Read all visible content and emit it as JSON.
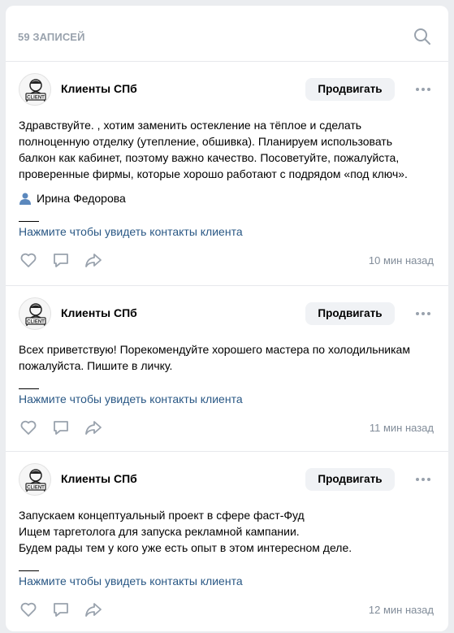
{
  "header": {
    "count": "59 ЗАПИСЕЙ"
  },
  "posts": [
    {
      "author": "Клиенты СПб",
      "promote": "Продвигать",
      "text": "Здравствуйте. , хотим заменить остекление на тёплое и сделать\nполноценную отделку (утепление, обшивка). Планируем использовать\nбалкон как кабинет, поэтому важно качество. Посоветуйте, пожалуйста,\nпроверенные фирмы, которые хорошо работают с подрядом «под ключ».",
      "signer": "Ирина Федорова",
      "contacts": "Нажмите чтобы увидеть контакты клиента",
      "time": "10 мин назад"
    },
    {
      "author": "Клиенты СПб",
      "promote": "Продвигать",
      "text": "Всех приветствую! Порекомендуйте хорошего мастера по холодильникам\nпожалуйста. Пишите в личку.",
      "contacts": "Нажмите чтобы увидеть контакты клиента",
      "time": "11 мин назад"
    },
    {
      "author": "Клиенты СПб",
      "promote": "Продвигать",
      "text": "Запускаем концептуальный проект в сфере фаст-Фуд\nИщем таргетолога для запуска рекламной кампании.\nБудем рады тем у кого уже есть опыт в этом интересном деле.",
      "contacts": "Нажмите чтобы увидеть контакты клиента",
      "time": "12 мин назад"
    }
  ],
  "avatar_label": "CLIENT",
  "colors": {
    "link": "#2a5885",
    "muted": "#818c99",
    "icon": "#99a2ad",
    "background": "#ebedf0"
  }
}
